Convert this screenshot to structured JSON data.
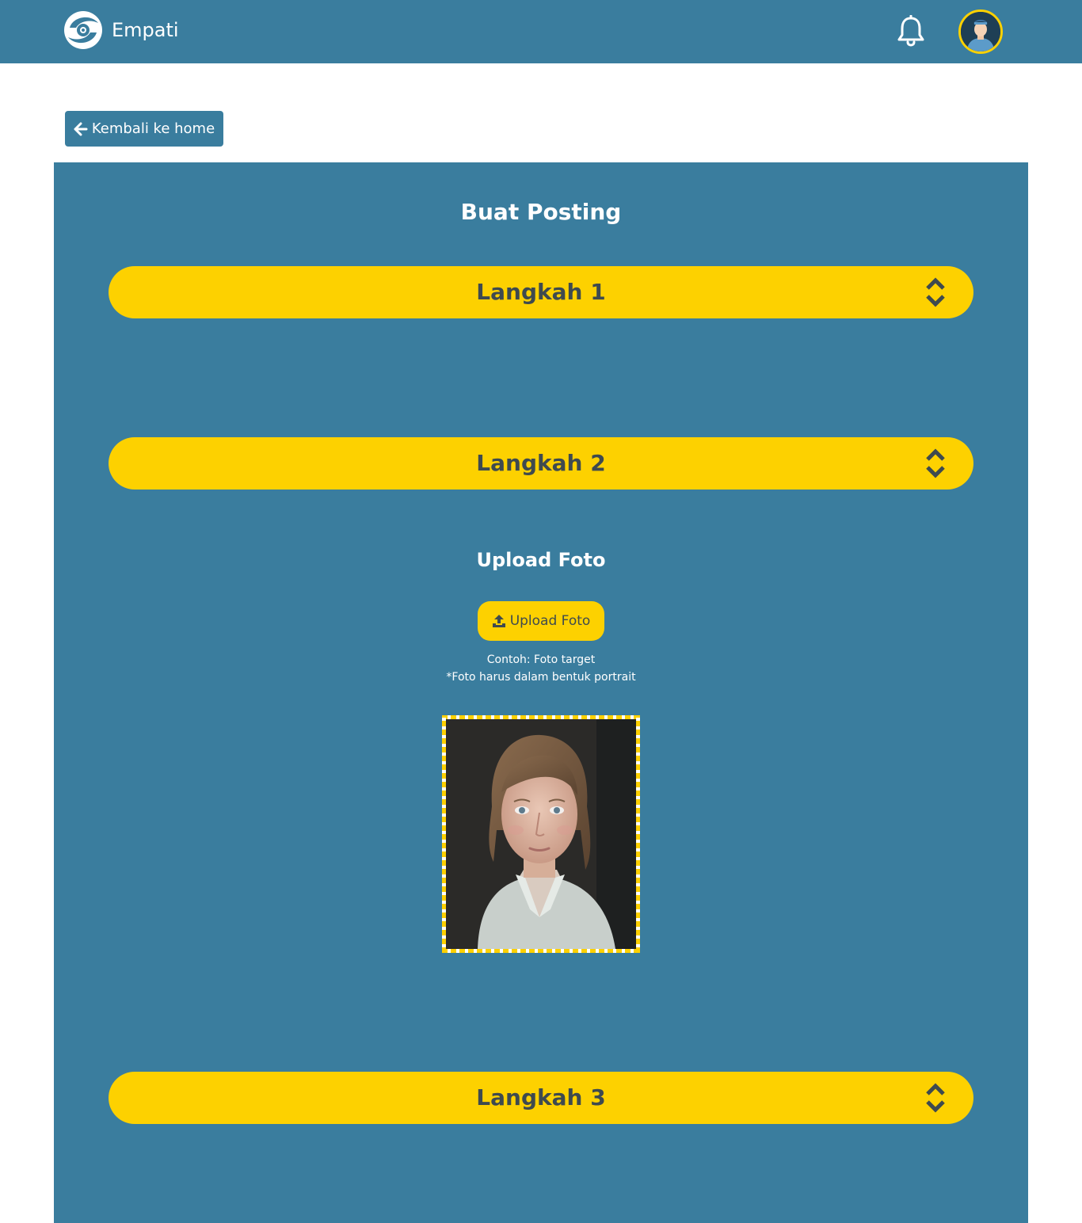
{
  "navbar": {
    "brand": "Empati",
    "logo_icon": "empati-logo-icon",
    "bell_icon": "bell-icon",
    "avatar_icon": "user-avatar-icon",
    "colors": {
      "background": "#3A7D9E",
      "avatar_border": "#FDD100"
    }
  },
  "back_button": {
    "label": "Kembali ke home",
    "icon": "arrow-left-icon"
  },
  "form": {
    "title": "Buat Posting",
    "steps": [
      {
        "label": "Langkah 1",
        "icon": "sort-chevrons-icon"
      },
      {
        "label": "Langkah 2",
        "icon": "sort-chevrons-icon"
      },
      {
        "label": "Langkah 3",
        "icon": "sort-chevrons-icon"
      }
    ],
    "upload": {
      "title": "Upload Foto",
      "button_label": "Upload Foto",
      "button_icon": "upload-icon",
      "hint_line1": "Contoh: Foto target",
      "hint_line2": "*Foto harus dalam bentuk portrait",
      "preview": "portrait-photo-example"
    },
    "colors": {
      "panel": "#3A7D9E",
      "accent": "#FDD100",
      "step_text": "#3E4A4F"
    }
  }
}
